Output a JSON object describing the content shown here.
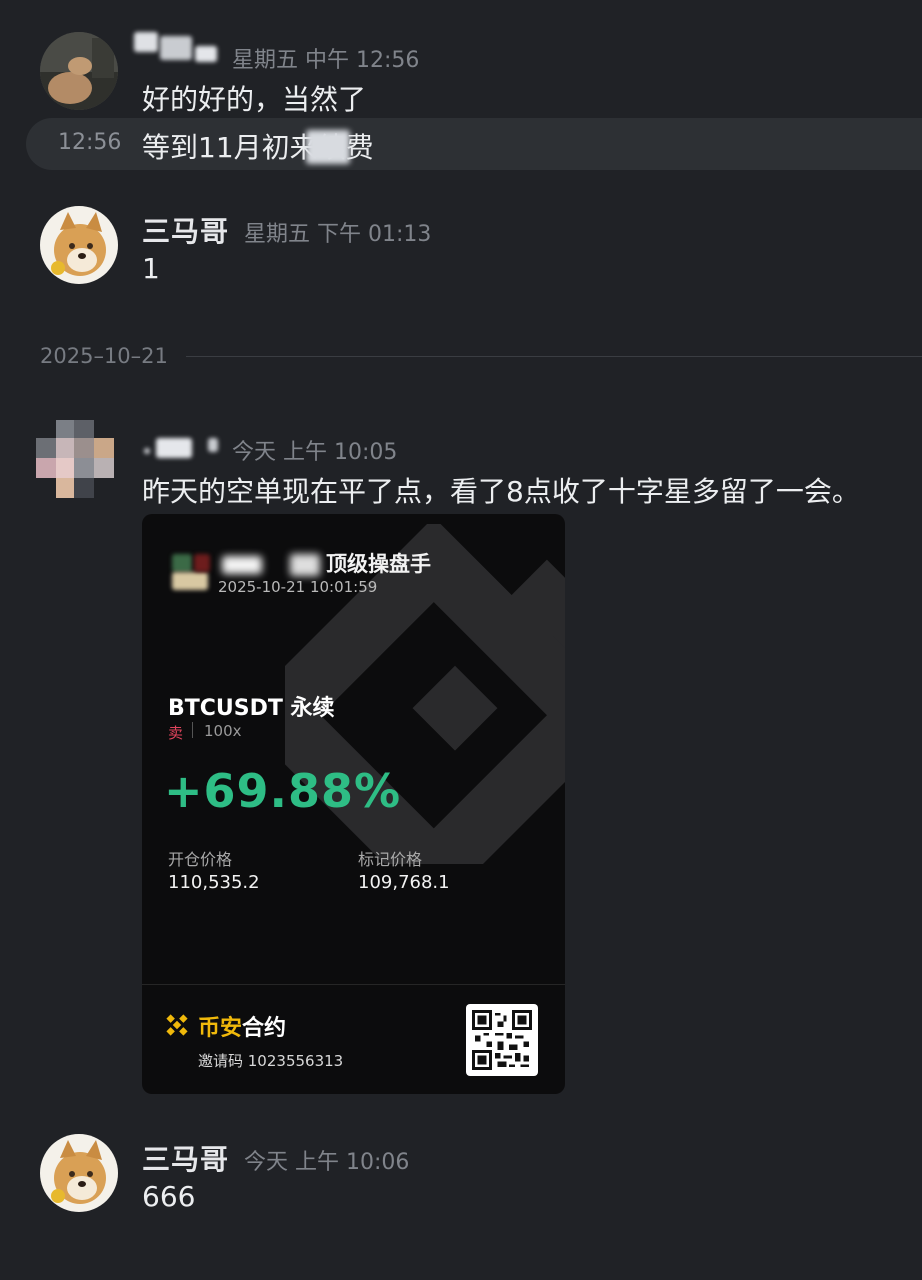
{
  "messages": [
    {
      "sender": "",
      "time": "星期五 中午 12:56",
      "text": "好的好的，当然了"
    },
    {
      "side_time": "12:56",
      "text": "等到11月初来续费"
    },
    {
      "sender": "三马哥",
      "time": "星期五 下午 01:13",
      "text": "1"
    },
    {
      "date_divider": "2025–10–21"
    },
    {
      "sender": "",
      "time": "今天 上午 10:05",
      "text": "昨天的空单现在平了点，看了8点收了十字星多留了一会。"
    },
    {
      "sender": "三马哥",
      "time": "今天 上午 10:06",
      "text": "666"
    }
  ],
  "card": {
    "title": "顶级操盘手",
    "timestamp": "2025-10-21 10:01:59",
    "pair": "BTCUSDT 永续",
    "side": "卖",
    "leverage": "100x",
    "pnl": "+69.88%",
    "entry_label": "开仓价格",
    "entry_value": "110,535.2",
    "mark_label": "标记价格",
    "mark_value": "109,768.1",
    "brand_accent": "币安",
    "brand_rest": "合约",
    "invite": "邀请码 1023556313",
    "colors": {
      "profit": "#2ebd85",
      "sell": "#e0445c",
      "brand": "#f0b90b"
    }
  }
}
